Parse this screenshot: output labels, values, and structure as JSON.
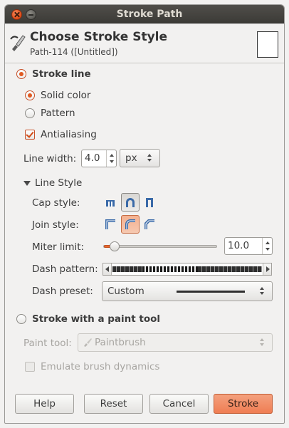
{
  "window": {
    "title": "Stroke Path"
  },
  "header": {
    "title": "Choose Stroke Style",
    "subtitle": "Path-114 ([Untitled])"
  },
  "stroke_line": {
    "label": "Stroke line",
    "selected": true,
    "solid_color": {
      "label": "Solid color",
      "selected": true
    },
    "pattern": {
      "label": "Pattern",
      "selected": false
    },
    "antialiasing": {
      "label": "Antialiasing",
      "checked": true
    },
    "line_width": {
      "label": "Line width:",
      "value": "4.0",
      "unit": "px"
    },
    "line_style": {
      "label": "Line Style",
      "cap_style": {
        "label": "Cap style:",
        "options": [
          "cap-butt-icon",
          "cap-round-icon",
          "cap-square-icon"
        ],
        "selected": "cap-round-icon"
      },
      "join_style": {
        "label": "Join style:",
        "options": [
          "join-miter-icon",
          "join-round-icon",
          "join-bevel-icon"
        ],
        "selected": "join-round-icon"
      },
      "miter_limit": {
        "label": "Miter limit:",
        "value": "10.0",
        "slider_fraction": 0.1
      },
      "dash_pattern": {
        "label": "Dash pattern:"
      },
      "dash_preset": {
        "label": "Dash preset:",
        "value": "Custom"
      }
    }
  },
  "paint_tool_option": {
    "label": "Stroke with a paint tool",
    "selected": false,
    "paint_tool": {
      "label": "Paint tool:",
      "value": "Paintbrush"
    },
    "emulate": {
      "label": "Emulate brush dynamics",
      "checked": false
    }
  },
  "buttons": {
    "help": "Help",
    "reset": "Reset",
    "cancel": "Cancel",
    "stroke": "Stroke"
  },
  "colors": {
    "accent": "#e8692f",
    "titlebar": "#3c3b37",
    "primary_button": "#f08a5f"
  }
}
